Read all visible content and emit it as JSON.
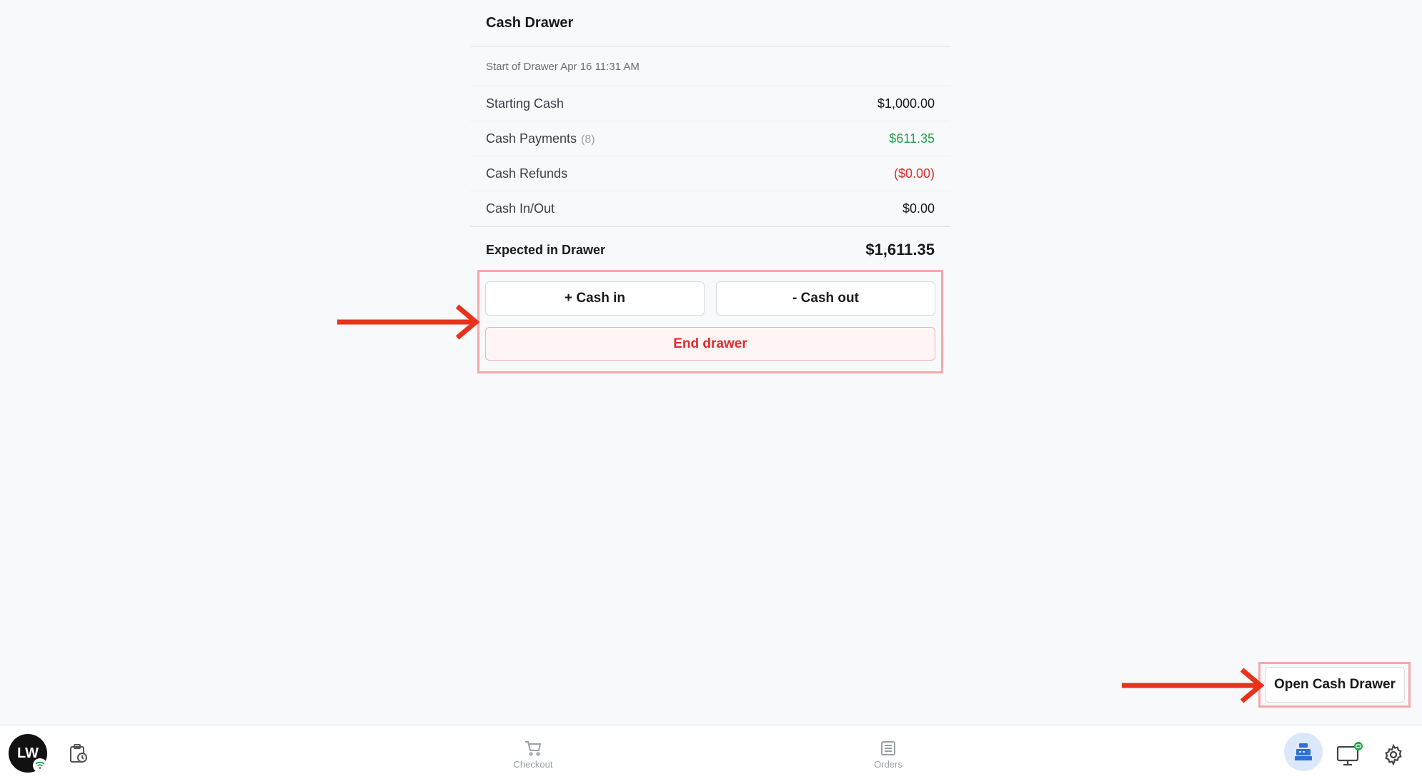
{
  "panel": {
    "title": "Cash Drawer",
    "subtitle": "Start of Drawer Apr 16 11:31 AM",
    "rows": [
      {
        "label": "Starting Cash",
        "value": "$1,000.00"
      },
      {
        "label": "Cash Payments",
        "count": "(8)",
        "value": "$611.35"
      },
      {
        "label": "Cash Refunds",
        "value": "($0.00)"
      },
      {
        "label": "Cash In/Out",
        "value": "$0.00"
      }
    ],
    "total": {
      "label": "Expected in Drawer",
      "value": "$1,611.35"
    }
  },
  "actions": {
    "cash_in": "+ Cash in",
    "cash_out": "- Cash out",
    "end_drawer": "End drawer"
  },
  "open_drawer_label": "Open Cash Drawer",
  "bottombar": {
    "avatar_initials": "LW",
    "nav": [
      {
        "label": "Checkout",
        "icon": "cart-icon"
      },
      {
        "label": "Orders",
        "icon": "orders-list-icon"
      }
    ]
  },
  "colors": {
    "positive": "#22a447",
    "negative": "#e02c2c",
    "annotation_red": "#e8321c",
    "highlight_border": "#f4a9a9",
    "active_bg": "#dbe7fb",
    "accent_blue": "#2f6fd6"
  }
}
